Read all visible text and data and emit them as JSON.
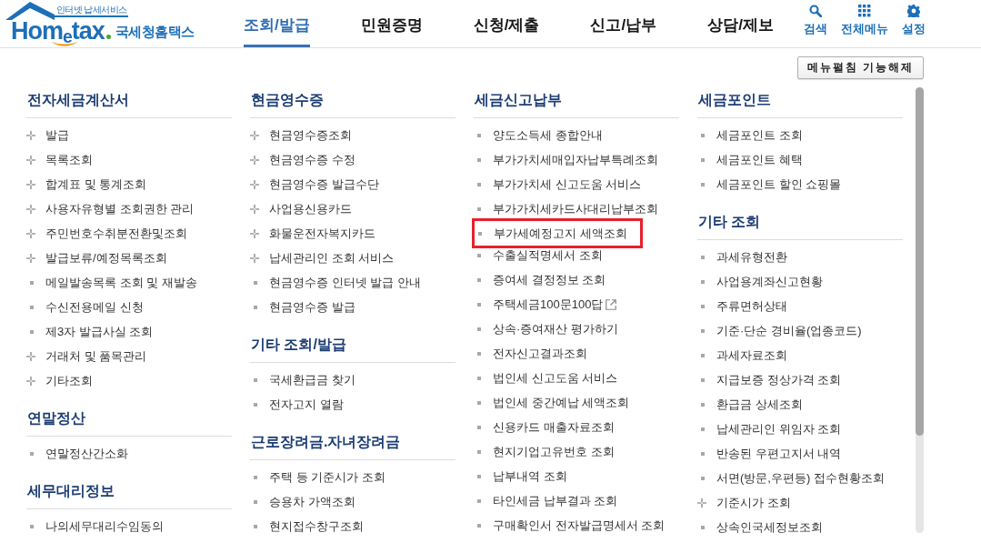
{
  "header": {
    "logo": {
      "tagline": "인터넷 납세서비스",
      "brand": "Hom$_{e}$tax",
      "name": "국세청홈택스"
    },
    "nav": [
      {
        "label": "조회/발급",
        "selected": true
      },
      {
        "label": "민원증명",
        "selected": false
      },
      {
        "label": "신청/제출",
        "selected": false
      },
      {
        "label": "신고/납부",
        "selected": false
      },
      {
        "label": "상담/제보",
        "selected": false
      }
    ],
    "tools": [
      {
        "kind": "search",
        "label": "검색"
      },
      {
        "kind": "menu",
        "label": "전체메뉴"
      },
      {
        "kind": "settings",
        "label": "설정"
      }
    ]
  },
  "toggle_button": "메뉴펼침 기능해제",
  "columns": [
    {
      "sections": [
        {
          "title": "전자세금계산서",
          "items": [
            {
              "label": "발급",
              "kind": "submenu",
              "highlighted": false
            },
            {
              "label": "목록조회",
              "kind": "submenu",
              "highlighted": false
            },
            {
              "label": "합계표 및 통계조회",
              "kind": "submenu",
              "highlighted": false
            },
            {
              "label": "사용자유형별 조회권한 관리",
              "kind": "submenu",
              "highlighted": false
            },
            {
              "label": "주민번호수취분전환및조회",
              "kind": "submenu",
              "highlighted": false
            },
            {
              "label": "발급보류/예정목록조회",
              "kind": "submenu",
              "highlighted": false
            },
            {
              "label": "메일발송목록 조회 및 재발송",
              "kind": "link",
              "highlighted": false
            },
            {
              "label": "수신전용메일 신청",
              "kind": "link",
              "highlighted": false
            },
            {
              "label": "제3자 발급사실 조회",
              "kind": "link",
              "highlighted": false
            },
            {
              "label": "거래처 및 품목관리",
              "kind": "submenu",
              "highlighted": false
            },
            {
              "label": "기타조회",
              "kind": "submenu",
              "highlighted": false
            }
          ]
        },
        {
          "title": "연말정산",
          "items": [
            {
              "label": "연말정산간소화",
              "kind": "link",
              "highlighted": false
            }
          ]
        },
        {
          "title": "세무대리정보",
          "items": [
            {
              "label": "나의세무대리수임동의",
              "kind": "link",
              "highlighted": false
            }
          ]
        }
      ]
    },
    {
      "sections": [
        {
          "title": "현금영수증",
          "items": [
            {
              "label": "현금영수증조회",
              "kind": "submenu",
              "highlighted": false
            },
            {
              "label": "현금영수증 수정",
              "kind": "submenu",
              "highlighted": false
            },
            {
              "label": "현금영수증 발급수단",
              "kind": "submenu",
              "highlighted": false
            },
            {
              "label": "사업용신용카드",
              "kind": "submenu",
              "highlighted": false
            },
            {
              "label": "화물운전자복지카드",
              "kind": "submenu",
              "highlighted": false
            },
            {
              "label": "납세관리인 조회 서비스",
              "kind": "submenu",
              "highlighted": false
            },
            {
              "label": "현금영수증 인터넷 발급 안내",
              "kind": "link",
              "highlighted": false
            },
            {
              "label": "현금영수증 발급",
              "kind": "link",
              "highlighted": false
            }
          ]
        },
        {
          "title": "기타 조회/발급",
          "items": [
            {
              "label": "국세환급금 찾기",
              "kind": "link",
              "highlighted": false
            },
            {
              "label": "전자고지 열람",
              "kind": "link",
              "highlighted": false
            }
          ]
        },
        {
          "title": "근로장려금.자녀장려금",
          "items": [
            {
              "label": "주택 등 기준시가 조회",
              "kind": "link",
              "highlighted": false
            },
            {
              "label": "승용차 가액조회",
              "kind": "link",
              "highlighted": false
            },
            {
              "label": "현지접수창구조회",
              "kind": "link",
              "highlighted": false
            }
          ]
        }
      ]
    },
    {
      "sections": [
        {
          "title": "세금신고납부",
          "items": [
            {
              "label": "양도소득세 종합안내",
              "kind": "link",
              "highlighted": false
            },
            {
              "label": "부가가치세매입자납부특례조회",
              "kind": "link",
              "highlighted": false
            },
            {
              "label": "부가가치세 신고도움 서비스",
              "kind": "link",
              "highlighted": false
            },
            {
              "label": "부가가치세카드사대리납부조회",
              "kind": "link",
              "highlighted": false
            },
            {
              "label": "부가세예정고지 세액조회",
              "kind": "link",
              "highlighted": true
            },
            {
              "label": "수출실적명세서 조회",
              "kind": "link",
              "highlighted": false
            },
            {
              "label": "증여세 결정정보 조회",
              "kind": "link",
              "highlighted": false
            },
            {
              "label": "주택세금100문100답",
              "kind": "external",
              "highlighted": false
            },
            {
              "label": "상속·증여재산 평가하기",
              "kind": "link",
              "highlighted": false
            },
            {
              "label": "전자신고결과조회",
              "kind": "link",
              "highlighted": false
            },
            {
              "label": "법인세 신고도움 서비스",
              "kind": "link",
              "highlighted": false
            },
            {
              "label": "법인세 중간예납 세액조회",
              "kind": "link",
              "highlighted": false
            },
            {
              "label": "신용카드 매출자료조회",
              "kind": "link",
              "highlighted": false
            },
            {
              "label": "현지기업고유번호 조회",
              "kind": "link",
              "highlighted": false
            },
            {
              "label": "납부내역 조회",
              "kind": "link",
              "highlighted": false
            },
            {
              "label": "타인세금 납부결과 조회",
              "kind": "link",
              "highlighted": false
            },
            {
              "label": "구매확인서 전자발급명세서 조회",
              "kind": "link",
              "highlighted": false
            }
          ]
        }
      ]
    },
    {
      "sections": [
        {
          "title": "세금포인트",
          "items": [
            {
              "label": "세금포인트 조회",
              "kind": "link",
              "highlighted": false
            },
            {
              "label": "세금포인트 혜택",
              "kind": "link",
              "highlighted": false
            },
            {
              "label": "세금포인트 할인 쇼핑몰",
              "kind": "link",
              "highlighted": false
            }
          ]
        },
        {
          "title": "기타 조회",
          "items": [
            {
              "label": "과세유형전환",
              "kind": "link",
              "highlighted": false
            },
            {
              "label": "사업용계좌신고현황",
              "kind": "link",
              "highlighted": false
            },
            {
              "label": "주류면허상태",
              "kind": "link",
              "highlighted": false
            },
            {
              "label": "기준·단순 경비율(업종코드)",
              "kind": "link",
              "highlighted": false
            },
            {
              "label": "과세자료조회",
              "kind": "link",
              "highlighted": false
            },
            {
              "label": "지급보증 정상가격 조회",
              "kind": "link",
              "highlighted": false
            },
            {
              "label": "환급금 상세조회",
              "kind": "link",
              "highlighted": false
            },
            {
              "label": "납세관리인 위임자 조회",
              "kind": "link",
              "highlighted": false
            },
            {
              "label": "반송된 우편고지서 내역",
              "kind": "link",
              "highlighted": false
            },
            {
              "label": "서면(방문,우편등) 접수현황조회",
              "kind": "link",
              "highlighted": false
            },
            {
              "label": "기준시가 조회",
              "kind": "submenu",
              "highlighted": false
            },
            {
              "label": "상속인국세정보조회",
              "kind": "link",
              "highlighted": false
            }
          ]
        }
      ]
    }
  ]
}
